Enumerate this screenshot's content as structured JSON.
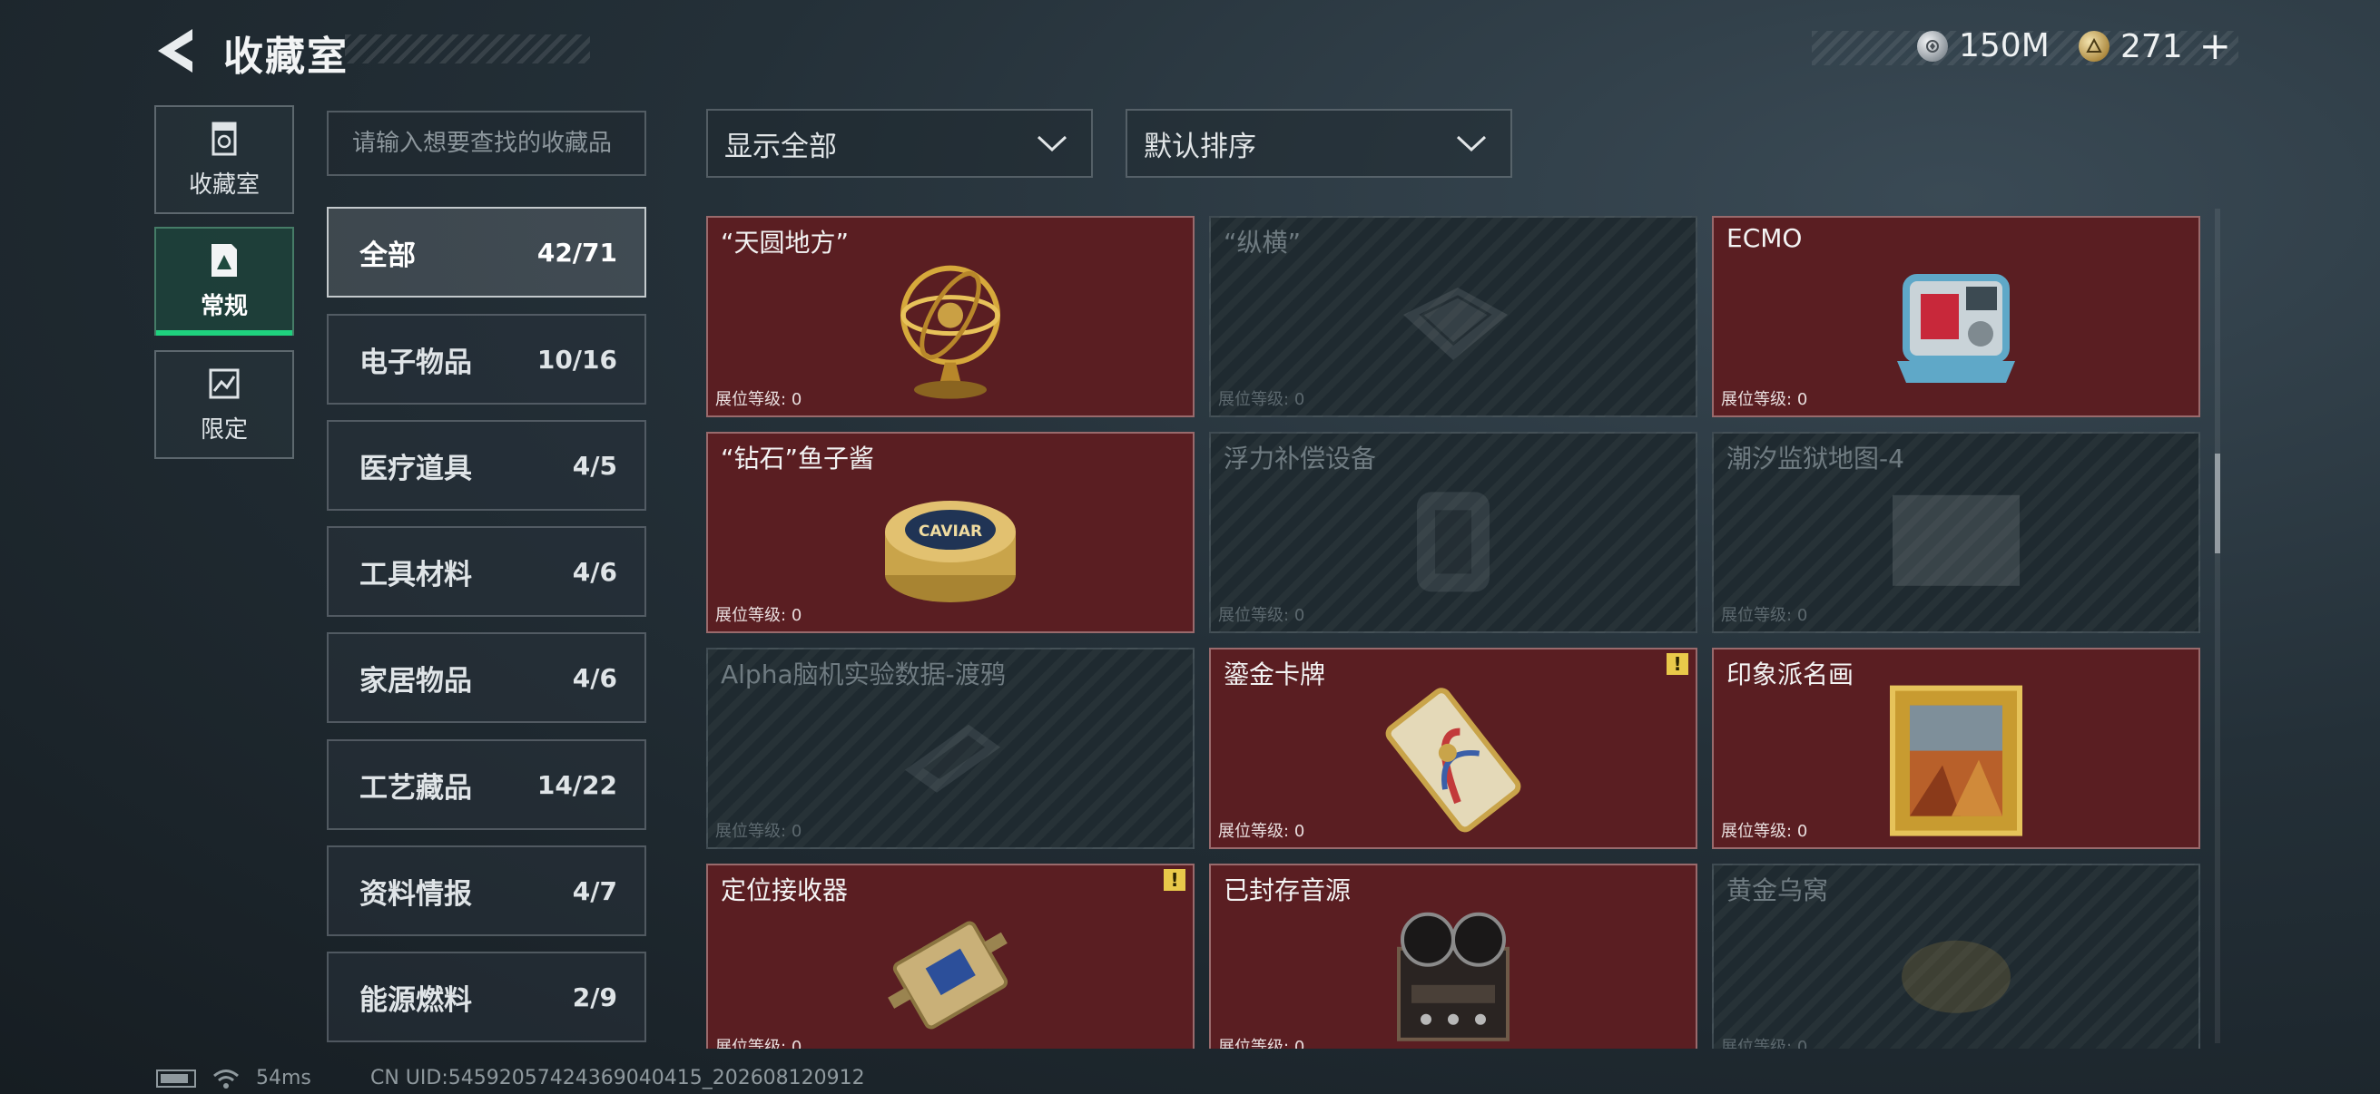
{
  "header": {
    "title": "收藏室",
    "currency": [
      {
        "icon": "silver-coin-icon",
        "amount": "150M"
      },
      {
        "icon": "gold-coin-icon",
        "amount": "271"
      }
    ],
    "add_label": "+"
  },
  "rail": [
    {
      "icon": "trophy-case-icon",
      "label": "收藏室",
      "active": false
    },
    {
      "icon": "regular-collection-icon",
      "label": "常规",
      "active": true
    },
    {
      "icon": "limited-map-icon",
      "label": "限定",
      "active": false
    }
  ],
  "search": {
    "placeholder": "请输入想要查找的收藏品"
  },
  "categories": [
    {
      "name": "全部",
      "count": "42/71",
      "active": true
    },
    {
      "name": "电子物品",
      "count": "10/16"
    },
    {
      "name": "医疗道具",
      "count": "4/5"
    },
    {
      "name": "工具材料",
      "count": "4/6"
    },
    {
      "name": "家居物品",
      "count": "4/6"
    },
    {
      "name": "工艺藏品",
      "count": "14/22"
    },
    {
      "name": "资料情报",
      "count": "4/7"
    },
    {
      "name": "能源燃料",
      "count": "2/9"
    }
  ],
  "filters": {
    "show": "显示全部",
    "sort": "默认排序"
  },
  "level_label": "展位等级:",
  "items": [
    {
      "name": "“天圆地方”",
      "level": "0",
      "owned": true,
      "icon": "armillary-sphere-icon",
      "alert": false
    },
    {
      "name": "“纵横”",
      "level": "0",
      "owned": false,
      "icon": "chessboard-icon",
      "alert": false
    },
    {
      "name": "ECMO",
      "level": "0",
      "owned": true,
      "icon": "ecmo-machine-icon",
      "alert": false
    },
    {
      "name": "“钻石”鱼子酱",
      "level": "0",
      "owned": true,
      "icon": "caviar-tin-icon",
      "alert": false,
      "tin_label": "CAVIAR"
    },
    {
      "name": "浮力补偿设备",
      "level": "0",
      "owned": false,
      "icon": "buoyancy-device-icon",
      "alert": false
    },
    {
      "name": "潮汐监狱地图-4",
      "level": "0",
      "owned": false,
      "icon": "map-icon",
      "alert": false
    },
    {
      "name": "Alpha脑机实验数据-渡鸦",
      "level": "0",
      "owned": false,
      "icon": "data-drive-icon",
      "alert": false
    },
    {
      "name": "鎏金卡牌",
      "level": "0",
      "owned": true,
      "icon": "gilded-card-icon",
      "alert": true
    },
    {
      "name": "印象派名画",
      "level": "0",
      "owned": true,
      "icon": "framed-painting-icon",
      "alert": false
    },
    {
      "name": "定位接收器",
      "level": "0",
      "owned": true,
      "icon": "receiver-icon",
      "alert": true
    },
    {
      "name": "已封存音源",
      "level": "0",
      "owned": true,
      "icon": "reel-recorder-icon",
      "alert": false
    },
    {
      "name": "黄金乌窝",
      "level": "0",
      "owned": false,
      "icon": "golden-nest-icon",
      "alert": false
    }
  ],
  "alert_mark": "!",
  "footer": {
    "ping": "54ms",
    "uid": "CN UID:54592057424369040415_202608120912"
  }
}
